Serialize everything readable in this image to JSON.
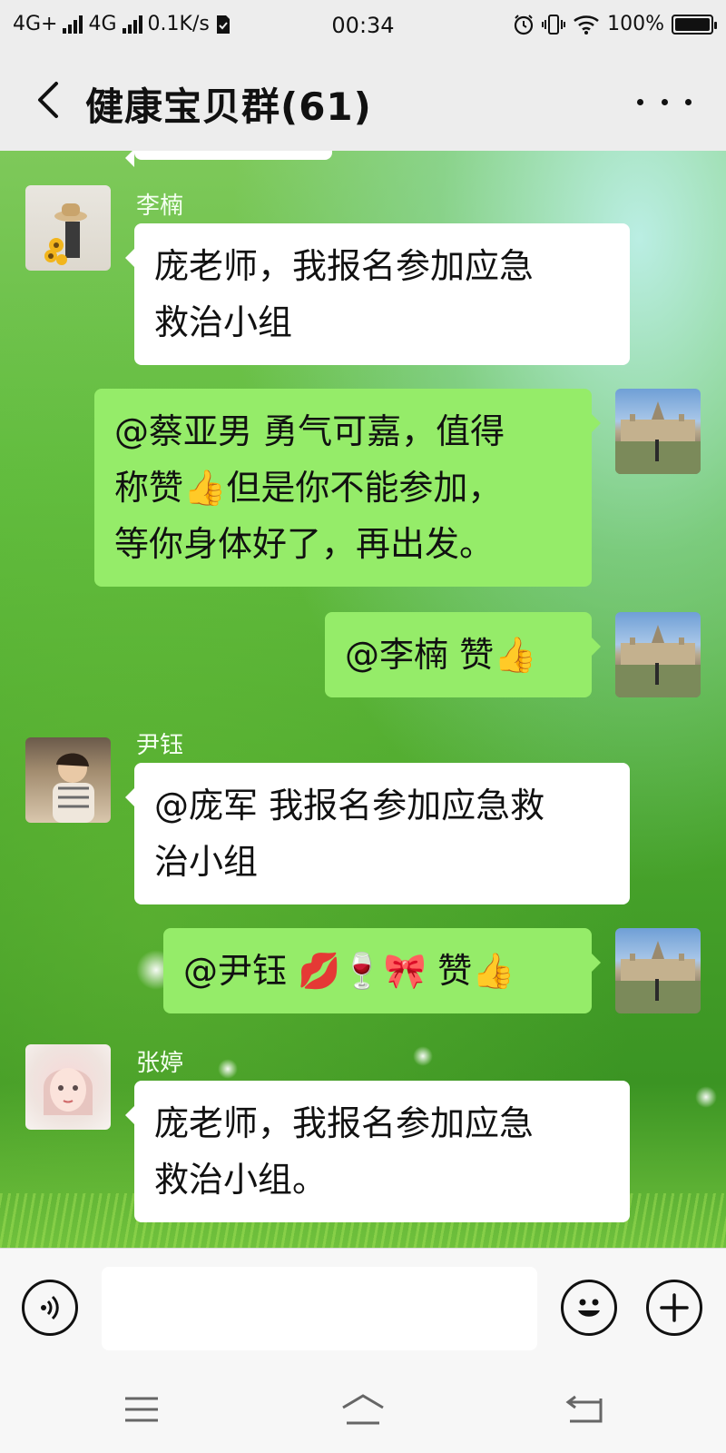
{
  "status_bar": {
    "network1": "4G+",
    "network2": "4G",
    "speed": "0.1K/s",
    "time": "00:34",
    "battery": "100%",
    "icons": [
      "signal-icon",
      "sim-check-icon",
      "alarm-icon",
      "vibrate-icon",
      "wifi-icon",
      "battery-icon"
    ]
  },
  "header": {
    "title": "健康宝贝群(61)"
  },
  "messages": [
    {
      "sender": "李楠",
      "direction": "in",
      "avatar": "sunflower-hat-avatar",
      "text_lines": [
        "庞老师，我报名参加应急",
        "救治小组"
      ]
    },
    {
      "direction": "out",
      "avatar": "castle-avatar",
      "text_lines": [
        "@蔡亚男  勇气可嘉，值得",
        "称赞👍但是你不能参加，",
        "等你身体好了，再出发。"
      ]
    },
    {
      "direction": "out",
      "avatar": "castle-avatar",
      "text_lines": [
        "@李楠  赞👍"
      ]
    },
    {
      "sender": "尹钰",
      "direction": "in",
      "avatar": "girl-photo-avatar",
      "text_lines": [
        "@庞军  我报名参加应急救",
        "治小组"
      ]
    },
    {
      "direction": "out",
      "avatar": "castle-avatar",
      "text_lines": [
        "@尹钰 💋🍷🎀 赞👍"
      ]
    },
    {
      "sender": "张婷",
      "direction": "in",
      "avatar": "cartoon-girl-avatar",
      "text_lines": [
        "庞老师，我报名参加应急",
        "救治小组。"
      ]
    }
  ],
  "input": {
    "value": "",
    "voice_icon": "voice-icon",
    "emoji_icon": "emoji-icon",
    "plus_icon": "plus-icon"
  },
  "nav": {
    "icons": [
      "menu-icon",
      "home-icon",
      "back-icon"
    ]
  },
  "colors": {
    "bubble_out": "#95ec69",
    "bubble_in": "#ffffff",
    "bar_bg": "#ededed"
  }
}
